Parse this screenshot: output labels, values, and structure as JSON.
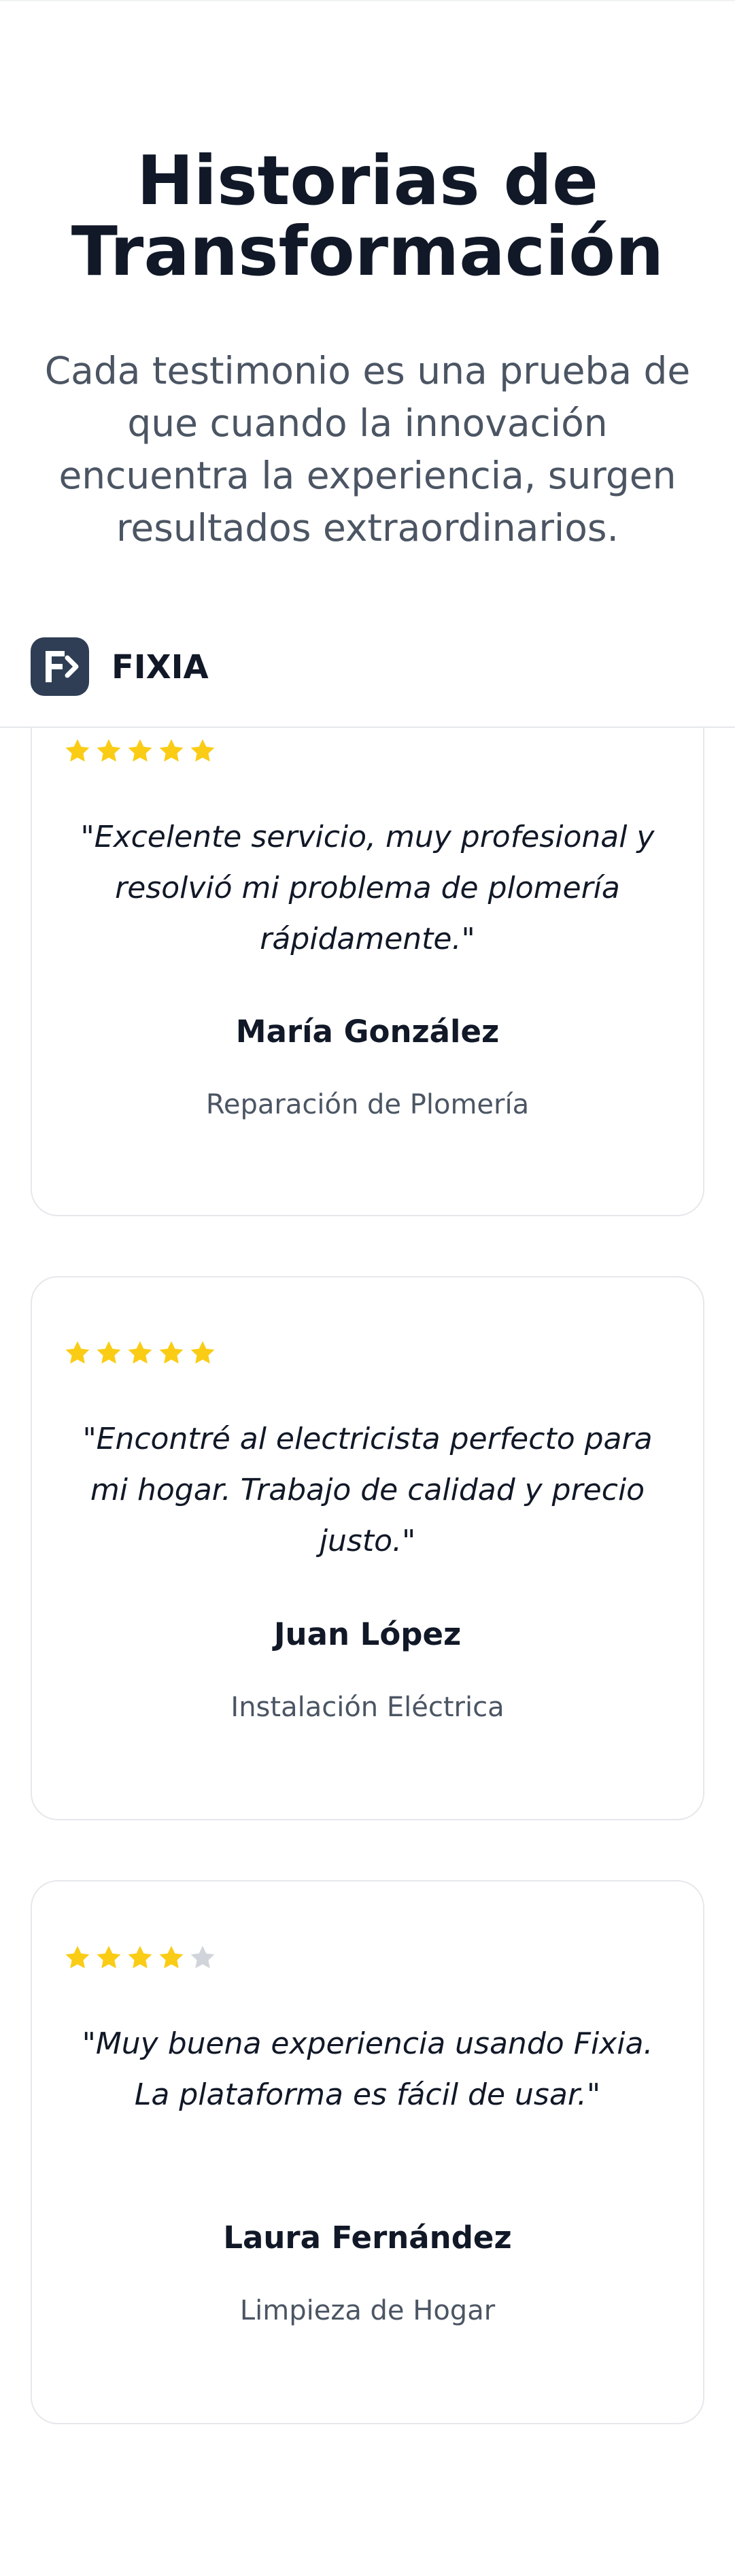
{
  "hero": {
    "title_line1": "Historias de",
    "title_line2": "Transformación",
    "subtitle": "Cada testimonio es una prueba de que cuando la innovación encuentra la experiencia, surgen resultados extraordinarios."
  },
  "navbar": {
    "brand": "FIXIA",
    "logo_icon": "fixia-logo-icon"
  },
  "colors": {
    "star_filled": "#facc15",
    "star_empty": "#d1d5db",
    "logo_bg": "#2f3e55"
  },
  "testimonials": [
    {
      "rating": 5,
      "quote": "\"Excelente servicio, muy profesional y resolvió mi problema de plomería rápidamente.\"",
      "name": "María González",
      "service": "Reparación de Plomería"
    },
    {
      "rating": 5,
      "quote": "\"Encontré al electricista perfecto para mi hogar. Trabajo de calidad y precio justo.\"",
      "name": "Juan López",
      "service": "Instalación Eléctrica"
    },
    {
      "rating": 4,
      "quote": "\"Muy buena experiencia usando Fixia. La plataforma es fácil de usar.\"",
      "name": "Laura Fernández",
      "service": "Limpieza de Hogar"
    }
  ]
}
